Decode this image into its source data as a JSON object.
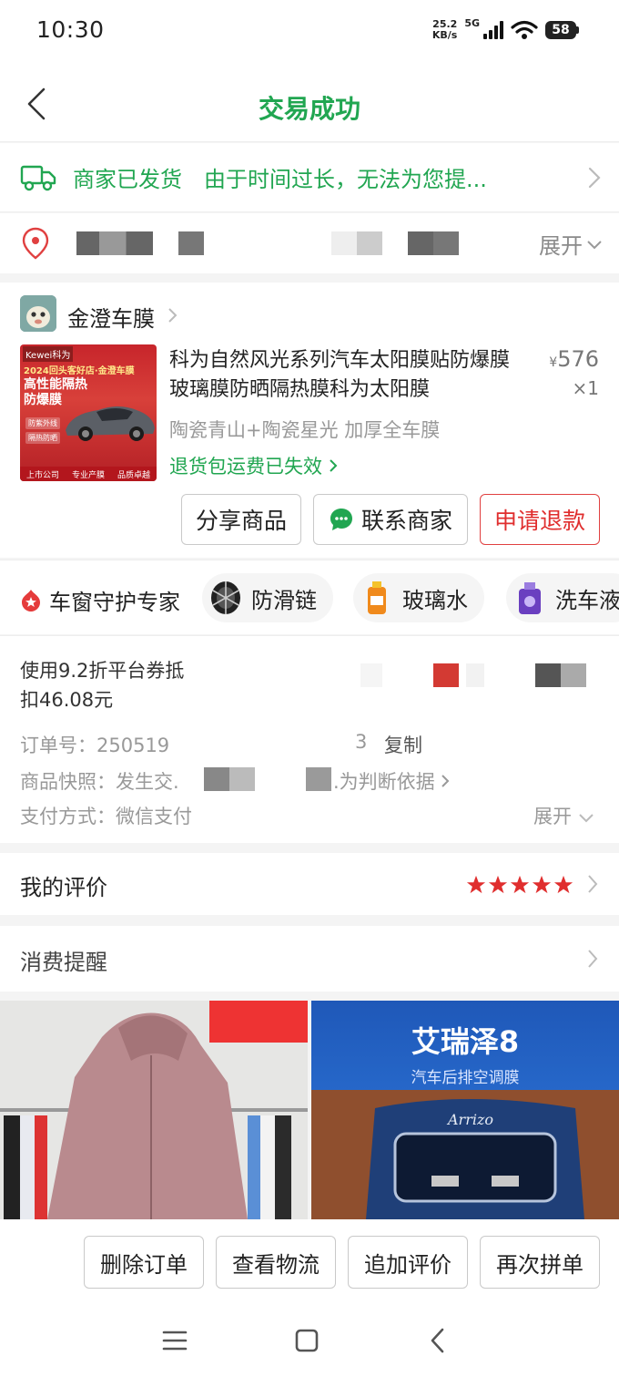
{
  "status_bar": {
    "time": "10:30",
    "net_speed_value": "25.2",
    "net_speed_unit": "KB/s",
    "network": "5G",
    "battery": "58"
  },
  "header": {
    "title": "交易成功"
  },
  "logistics": {
    "text": "商家已发货　由于时间过长，无法为您提..."
  },
  "address": {
    "expand_label": "展开"
  },
  "shop": {
    "name": "金澄车膜"
  },
  "product": {
    "title": "科为自然风光系列汽车太阳膜贴防爆膜玻璃膜防晒隔热膜科为太阳膜",
    "price_symbol": "¥",
    "price": "576",
    "quantity": "×1",
    "spec": "陶瓷青山+陶瓷星光 加厚全车膜",
    "return_note": "退货包运费已失效",
    "thumb": {
      "brand": "Kewei科为",
      "line1": "2024回头客好店·金澄车膜",
      "big": "高性能隔热防爆膜",
      "tag1": "防紫外线",
      "tag2": "隔热防晒",
      "bottom": [
        "上市公司",
        "专业产膜",
        "品质卓越"
      ]
    }
  },
  "product_actions": {
    "share": "分享商品",
    "contact": "联系商家",
    "refund": "申请退款"
  },
  "recommend": {
    "title": "车窗守护专家",
    "chips": [
      "防滑链",
      "玻璃水",
      "洗车液"
    ]
  },
  "order_info": {
    "coupon_line1": "使用9.2折平台券抵",
    "coupon_line2": "扣46.08元",
    "order_no_label": "订单号：",
    "order_no": "250519",
    "order_no_tail": "3",
    "copy": "复制",
    "snapshot_label": "商品快照：",
    "snapshot_text": "发生交.",
    "snapshot_tail": ".为判断依据",
    "payment_label": "支付方式：",
    "payment": "微信支付",
    "expand_label": "展开"
  },
  "review": {
    "label": "我的评价",
    "stars": 5
  },
  "reminder": {
    "label": "消费提醒"
  },
  "feed": {
    "ad_title": "艾瑞泽8",
    "ad_subtitle": "汽车后排空调膜"
  },
  "bottom_actions": [
    "删除订单",
    "查看物流",
    "追加评价",
    "再次拼单"
  ],
  "colors": {
    "accent_green": "#21a651",
    "accent_red": "#e02e2e",
    "star_red": "#e02e2e"
  }
}
